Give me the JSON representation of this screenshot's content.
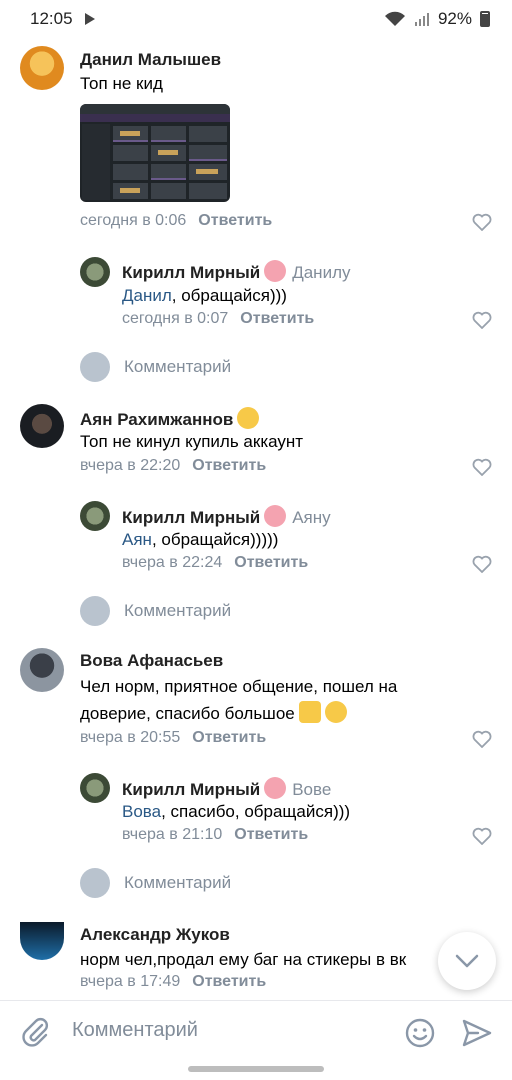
{
  "status_bar": {
    "time": "12:05",
    "battery": "92%"
  },
  "comments": [
    {
      "author": "Данил Малышев",
      "text": "Топ не кид",
      "date": "сегодня в 0:06",
      "reply_label": "Ответить",
      "has_image": true,
      "reply": {
        "author": "Кирилл Мирный",
        "reply_to": "Данилу",
        "mention": "Данил",
        "text": ", обращайся)))",
        "date": "сегодня в 0:07",
        "reply_label": "Ответить"
      },
      "write_placeholder": "Комментарий"
    },
    {
      "author": "Аян Рахимжаннов",
      "text": "Топ не кинул купиль аккаунт",
      "date": "вчера в 22:20",
      "reply_label": "Ответить",
      "reply": {
        "author": "Кирилл Мирный",
        "reply_to": "Аяну",
        "mention": "Аян",
        "text": ", обращайся)))))",
        "date": "вчера в 22:24",
        "reply_label": "Ответить"
      },
      "write_placeholder": "Комментарий"
    },
    {
      "author": "Вова Афанасьев",
      "text_line1": "Чел норм, приятное общение, пошел на",
      "text_line2": "доверие, спасибо большое",
      "date": "вчера в 20:55",
      "reply_label": "Ответить",
      "reply": {
        "author": "Кирилл Мирный",
        "reply_to": "Вове",
        "mention": "Вова",
        "text": ", спасибо, обращайся)))",
        "date": "вчера в 21:10",
        "reply_label": "Ответить"
      },
      "write_placeholder": "Комментарий"
    },
    {
      "author": "Александр Жуков",
      "text": "норм чел,продал ему баг на стикеры в вк",
      "date": "вчера в 17:49",
      "reply_label": "Ответить"
    }
  ],
  "bottom_bar": {
    "placeholder": "Комментарий"
  },
  "colors": {
    "link": "#2a5885",
    "meta": "#818c99",
    "accent": "#5181b8"
  }
}
